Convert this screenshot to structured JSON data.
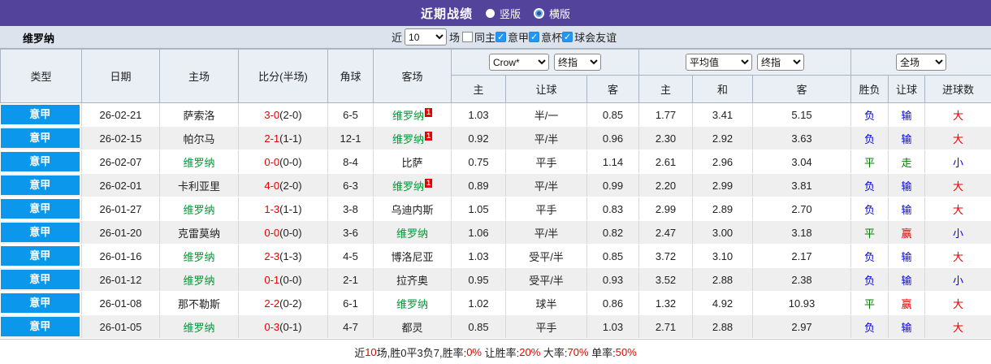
{
  "titlebar": {
    "title": "近期战绩",
    "radio_vertical": "竖版",
    "radio_horizontal": "横版"
  },
  "filter": {
    "team": "维罗纳",
    "near_label": "近",
    "count": "10",
    "matches_label": "场",
    "checkboxes": [
      {
        "label": "同主",
        "checked": false
      },
      {
        "label": "意甲",
        "checked": true
      },
      {
        "label": "意杯",
        "checked": true
      },
      {
        "label": "球会友谊",
        "checked": true
      }
    ]
  },
  "table": {
    "columns": [
      "类型",
      "日期",
      "主场",
      "比分(半场)",
      "角球",
      "客场"
    ],
    "selects": {
      "bookmaker": "Crow*",
      "bookmaker_index": "终指",
      "average": "平均值",
      "average_index": "终指",
      "scope": "全场"
    },
    "odds_headers": [
      "主",
      "让球",
      "客"
    ],
    "avg_headers": [
      "主",
      "和",
      "客"
    ],
    "result_headers": [
      "胜负",
      "让球",
      "进球数"
    ],
    "rows": [
      {
        "league": "意甲",
        "date": "26-02-21",
        "home": {
          "name": "萨索洛",
          "verona": false
        },
        "score": {
          "full": "3-0",
          "half": "(2-0)"
        },
        "corner": "6-5",
        "away": {
          "name": "维罗纳",
          "verona": true,
          "badge": "1"
        },
        "crown": [
          "1.03",
          "半/一",
          "0.85"
        ],
        "avg": [
          "1.77",
          "3.41",
          "5.15"
        ],
        "outcome": [
          {
            "text": "负",
            "color": "blue"
          },
          {
            "text": "输",
            "color": "blue"
          },
          {
            "text": "大",
            "color": "red"
          }
        ]
      },
      {
        "league": "意甲",
        "date": "26-02-15",
        "home": {
          "name": "帕尔马",
          "verona": false
        },
        "score": {
          "full": "2-1",
          "half": "(1-1)"
        },
        "corner": "12-1",
        "away": {
          "name": "维罗纳",
          "verona": true,
          "badge": "1"
        },
        "crown": [
          "0.92",
          "平/半",
          "0.96"
        ],
        "avg": [
          "2.30",
          "2.92",
          "3.63"
        ],
        "outcome": [
          {
            "text": "负",
            "color": "blue"
          },
          {
            "text": "输",
            "color": "blue"
          },
          {
            "text": "大",
            "color": "red"
          }
        ]
      },
      {
        "league": "意甲",
        "date": "26-02-07",
        "home": {
          "name": "维罗纳",
          "verona": true
        },
        "score": {
          "full": "0-0",
          "half": "(0-0)"
        },
        "corner": "8-4",
        "away": {
          "name": "比萨",
          "verona": false
        },
        "crown": [
          "0.75",
          "平手",
          "1.14"
        ],
        "avg": [
          "2.61",
          "2.96",
          "3.04"
        ],
        "outcome": [
          {
            "text": "平",
            "color": "green"
          },
          {
            "text": "走",
            "color": "green"
          },
          {
            "text": "小",
            "color": "blue"
          }
        ]
      },
      {
        "league": "意甲",
        "date": "26-02-01",
        "home": {
          "name": "卡利亚里",
          "verona": false
        },
        "score": {
          "full": "4-0",
          "half": "(2-0)"
        },
        "corner": "6-3",
        "away": {
          "name": "维罗纳",
          "verona": true,
          "badge": "1"
        },
        "crown": [
          "0.89",
          "平/半",
          "0.99"
        ],
        "avg": [
          "2.20",
          "2.99",
          "3.81"
        ],
        "outcome": [
          {
            "text": "负",
            "color": "blue"
          },
          {
            "text": "输",
            "color": "blue"
          },
          {
            "text": "大",
            "color": "red"
          }
        ]
      },
      {
        "league": "意甲",
        "date": "26-01-27",
        "home": {
          "name": "维罗纳",
          "verona": true
        },
        "score": {
          "full": "1-3",
          "half": "(1-1)"
        },
        "corner": "3-8",
        "away": {
          "name": "乌迪内斯",
          "verona": false
        },
        "crown": [
          "1.05",
          "平手",
          "0.83"
        ],
        "avg": [
          "2.99",
          "2.89",
          "2.70"
        ],
        "outcome": [
          {
            "text": "负",
            "color": "blue"
          },
          {
            "text": "输",
            "color": "blue"
          },
          {
            "text": "大",
            "color": "red"
          }
        ]
      },
      {
        "league": "意甲",
        "date": "26-01-20",
        "home": {
          "name": "克雷莫纳",
          "verona": false
        },
        "score": {
          "full": "0-0",
          "half": "(0-0)"
        },
        "corner": "3-6",
        "away": {
          "name": "维罗纳",
          "verona": true
        },
        "crown": [
          "1.06",
          "平/半",
          "0.82"
        ],
        "avg": [
          "2.47",
          "3.00",
          "3.18"
        ],
        "outcome": [
          {
            "text": "平",
            "color": "green"
          },
          {
            "text": "赢",
            "color": "red"
          },
          {
            "text": "小",
            "color": "blue"
          }
        ]
      },
      {
        "league": "意甲",
        "date": "26-01-16",
        "home": {
          "name": "维罗纳",
          "verona": true
        },
        "score": {
          "full": "2-3",
          "half": "(1-3)"
        },
        "corner": "4-5",
        "away": {
          "name": "博洛尼亚",
          "verona": false
        },
        "crown": [
          "1.03",
          "受平/半",
          "0.85"
        ],
        "avg": [
          "3.72",
          "3.10",
          "2.17"
        ],
        "outcome": [
          {
            "text": "负",
            "color": "blue"
          },
          {
            "text": "输",
            "color": "blue"
          },
          {
            "text": "大",
            "color": "red"
          }
        ]
      },
      {
        "league": "意甲",
        "date": "26-01-12",
        "home": {
          "name": "维罗纳",
          "verona": true
        },
        "score": {
          "full": "0-1",
          "half": "(0-0)"
        },
        "corner": "2-1",
        "away": {
          "name": "拉齐奥",
          "verona": false
        },
        "crown": [
          "0.95",
          "受平/半",
          "0.93"
        ],
        "avg": [
          "3.52",
          "2.88",
          "2.38"
        ],
        "outcome": [
          {
            "text": "负",
            "color": "blue"
          },
          {
            "text": "输",
            "color": "blue"
          },
          {
            "text": "小",
            "color": "blue"
          }
        ]
      },
      {
        "league": "意甲",
        "date": "26-01-08",
        "home": {
          "name": "那不勒斯",
          "verona": false
        },
        "score": {
          "full": "2-2",
          "half": "(0-2)"
        },
        "corner": "6-1",
        "away": {
          "name": "维罗纳",
          "verona": true
        },
        "crown": [
          "1.02",
          "球半",
          "0.86"
        ],
        "avg": [
          "1.32",
          "4.92",
          "10.93"
        ],
        "outcome": [
          {
            "text": "平",
            "color": "green"
          },
          {
            "text": "赢",
            "color": "red"
          },
          {
            "text": "大",
            "color": "red"
          }
        ]
      },
      {
        "league": "意甲",
        "date": "26-01-05",
        "home": {
          "name": "维罗纳",
          "verona": true
        },
        "score": {
          "full": "0-3",
          "half": "(0-1)"
        },
        "corner": "4-7",
        "away": {
          "name": "都灵",
          "verona": false
        },
        "crown": [
          "0.85",
          "平手",
          "1.03"
        ],
        "avg": [
          "2.71",
          "2.88",
          "2.97"
        ],
        "outcome": [
          {
            "text": "负",
            "color": "blue"
          },
          {
            "text": "输",
            "color": "blue"
          },
          {
            "text": "大",
            "color": "red"
          }
        ]
      }
    ]
  },
  "footer": {
    "segments": [
      {
        "text": "近",
        "color": "dark"
      },
      {
        "text": "10",
        "color": "red"
      },
      {
        "text": "场,胜0平3负7,胜率:",
        "color": "dark"
      },
      {
        "text": "0%",
        "color": "red"
      },
      {
        "text": " 让胜率:",
        "color": "dark"
      },
      {
        "text": "20%",
        "color": "red"
      },
      {
        "text": " 大率:",
        "color": "dark"
      },
      {
        "text": "70%",
        "color": "red"
      },
      {
        "text": " 单率:",
        "color": "dark"
      },
      {
        "text": "50%",
        "color": "red"
      }
    ]
  },
  "colors": {
    "accent_purple": "#54439B",
    "league_blue": "#0A97EC",
    "team_green": "#009933",
    "score_red": "#E80000",
    "loss_blue": "#0000E0",
    "draw_green": "#007D00",
    "win_red": "#E80000",
    "filterbar_bg": "#DCE3ED",
    "header_bg": "#EAEFF5",
    "row_alt_bg": "#EFEFEF",
    "crown_odds_bg": "#FFF9F0",
    "avg_odds_bg": "#EAF5FB",
    "checkbox_blue": "#2196F3"
  }
}
